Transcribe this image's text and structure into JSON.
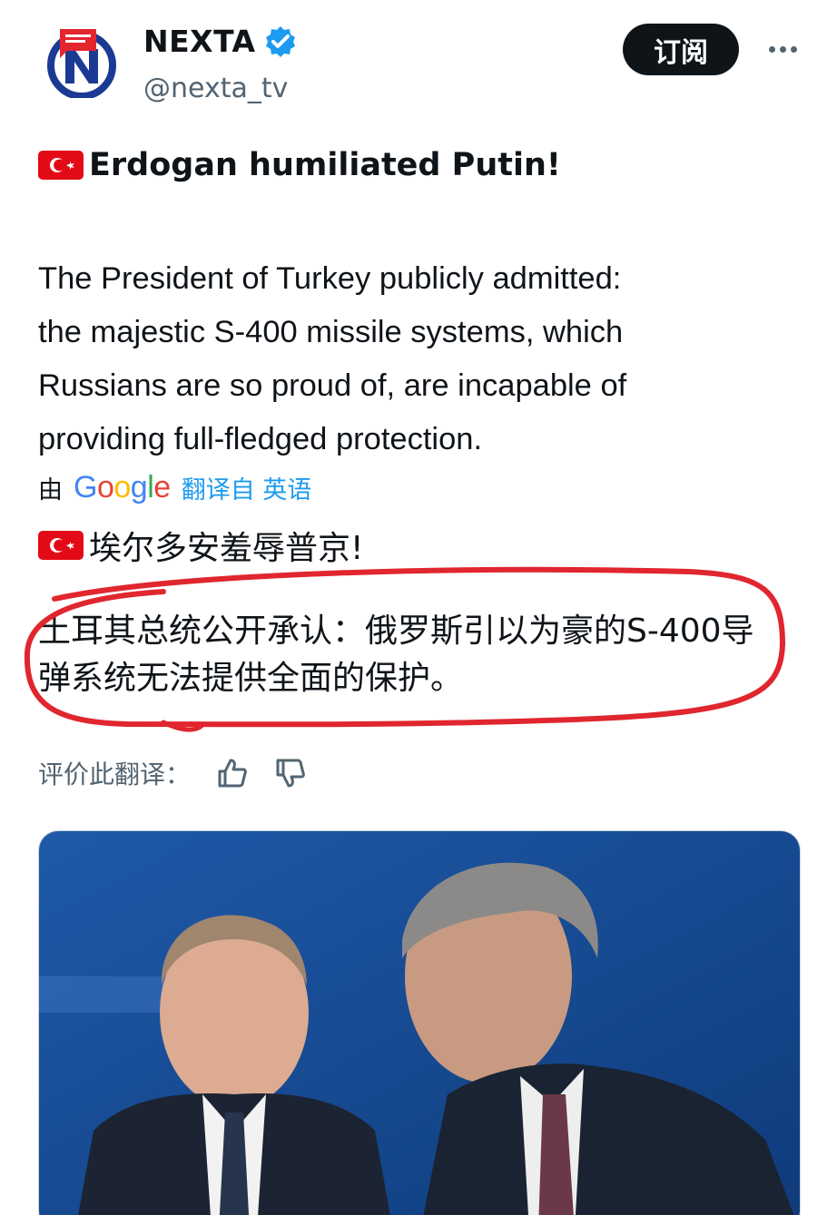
{
  "account": {
    "display_name": "NEXTA",
    "handle": "@nexta_tv",
    "verified": true,
    "avatar_icon": "nexta-logo-icon"
  },
  "actions": {
    "subscribe_label": "订阅",
    "more_icon": "more-horizontal-icon"
  },
  "tweet": {
    "headline": "Erdogan humiliated Putin!",
    "headline_flag_icon": "turkey-flag-icon",
    "body": "The President of Turkey publicly admitted:\nthe majestic S-400 missile systems, which\nRussians are so proud of, are incapable of\nproviding full-fledged protection."
  },
  "translation": {
    "by_prefix": "由",
    "provider": "Google",
    "translated_from": "翻译自 英语",
    "headline": "埃尔多安羞辱普京!",
    "body": "土耳其总统公开承认：俄罗斯引以为豪的S-400导弹系统无法提供全面的保护。",
    "rate_label": "评价此翻译：",
    "thumbs_up_icon": "thumbs-up-icon",
    "thumbs_down_icon": "thumbs-down-icon"
  },
  "colors": {
    "accent_blue": "#1d9bf0",
    "text_primary": "#0f1419",
    "text_secondary": "#536471",
    "annotation_red": "#e0262e",
    "flag_red": "#e30a17"
  }
}
